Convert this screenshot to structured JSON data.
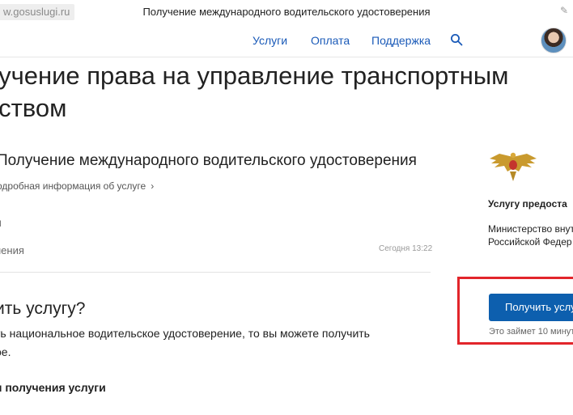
{
  "browser": {
    "url": "w.gosuslugi.ru",
    "document_title": "Получение международного водительского удостоверения"
  },
  "nav": {
    "items": [
      "Услуги",
      "Оплата",
      "Поддержка"
    ],
    "search_icon": "search-icon"
  },
  "page": {
    "heading_line1": "лучение права на управление транспортным",
    "heading_line2": "дством"
  },
  "service": {
    "title": "Получение международного водительского удостоверения",
    "more_info": "одробная информация об услуге",
    "label_1": "я",
    "label_2": "нения",
    "timestamp": "Сегодня 13:22"
  },
  "how_to": {
    "question": "ить услугу?",
    "paragraph_line1": "ть национальное водительское удостоверение, то вы можете получить",
    "paragraph_line2": "ое.",
    "steps_heading": "п получения услуги"
  },
  "provider": {
    "heading": "Услугу предоста",
    "name_line1": "Министерство внут",
    "name_line2": "Российской Федер"
  },
  "cta": {
    "button_label": "Получить услу",
    "eta": "Это займет 10 минут"
  },
  "colors": {
    "link": "#1a5ab8",
    "button": "#0d5fae",
    "highlight": "#e2252b"
  }
}
